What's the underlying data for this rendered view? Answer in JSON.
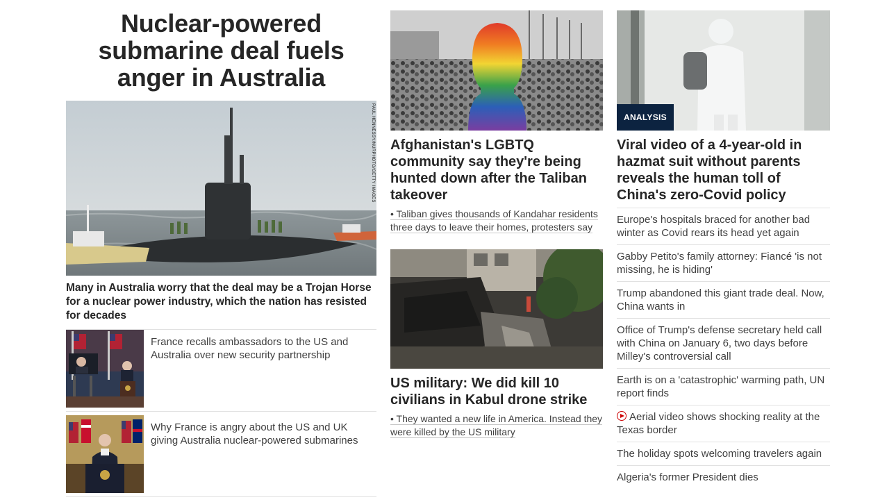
{
  "lead": {
    "headline": "Nuclear-powered submarine deal fuels anger in Australia",
    "photo_credit": "PAUL HENNESSY/NURPHOTO/GETTY IMAGES",
    "caption": "Many in Australia worry that the deal may be a Trojan Horse for a nuclear power industry, which the nation has resisted for decades",
    "related": [
      {
        "text": "France recalls ambassadors to the US and Australia over new security partnership"
      },
      {
        "text": "Why France is angry about the US and UK giving Australia nuclear-powered submarines"
      }
    ]
  },
  "middle": {
    "stories": [
      {
        "headline": "Afghanistan's LGBTQ community say they're being hunted down after the Taliban takeover",
        "bullet": "• Taliban gives thousands of Kandahar residents three days to leave their homes, protesters say"
      },
      {
        "headline": "US military: We did kill 10 civilians in Kabul drone strike",
        "bullet": "• They wanted a new life in America. Instead they were killed by the US military"
      }
    ]
  },
  "right": {
    "badge": "ANALYSIS",
    "headline": "Viral video of a 4-year-old in hazmat suit without parents reveals the human toll of China's zero-Covid policy",
    "list": [
      {
        "text": "Europe's hospitals braced for another bad winter as Covid rears its head yet again",
        "video": false
      },
      {
        "text": "Gabby Petito's family attorney: Fiancé 'is not missing, he is hiding'",
        "video": false
      },
      {
        "text": "Trump abandoned this giant trade deal. Now, China wants in",
        "video": false
      },
      {
        "text": "Office of Trump's defense secretary held call with China on January 6, two days before Milley's controversial call",
        "video": false
      },
      {
        "text": "Earth is on a 'catastrophic' warming path, UN report finds",
        "video": false
      },
      {
        "text": "Aerial video shows shocking reality at the Texas border",
        "video": true
      },
      {
        "text": "The holiday spots welcoming travelers again",
        "video": false
      },
      {
        "text": "Algeria's former President dies",
        "video": false
      }
    ]
  },
  "colors": {
    "text": "#262626",
    "secondary": "#404040",
    "divider": "#e1e1e1",
    "badge": "#0c2340",
    "video_red": "#cc0000"
  }
}
